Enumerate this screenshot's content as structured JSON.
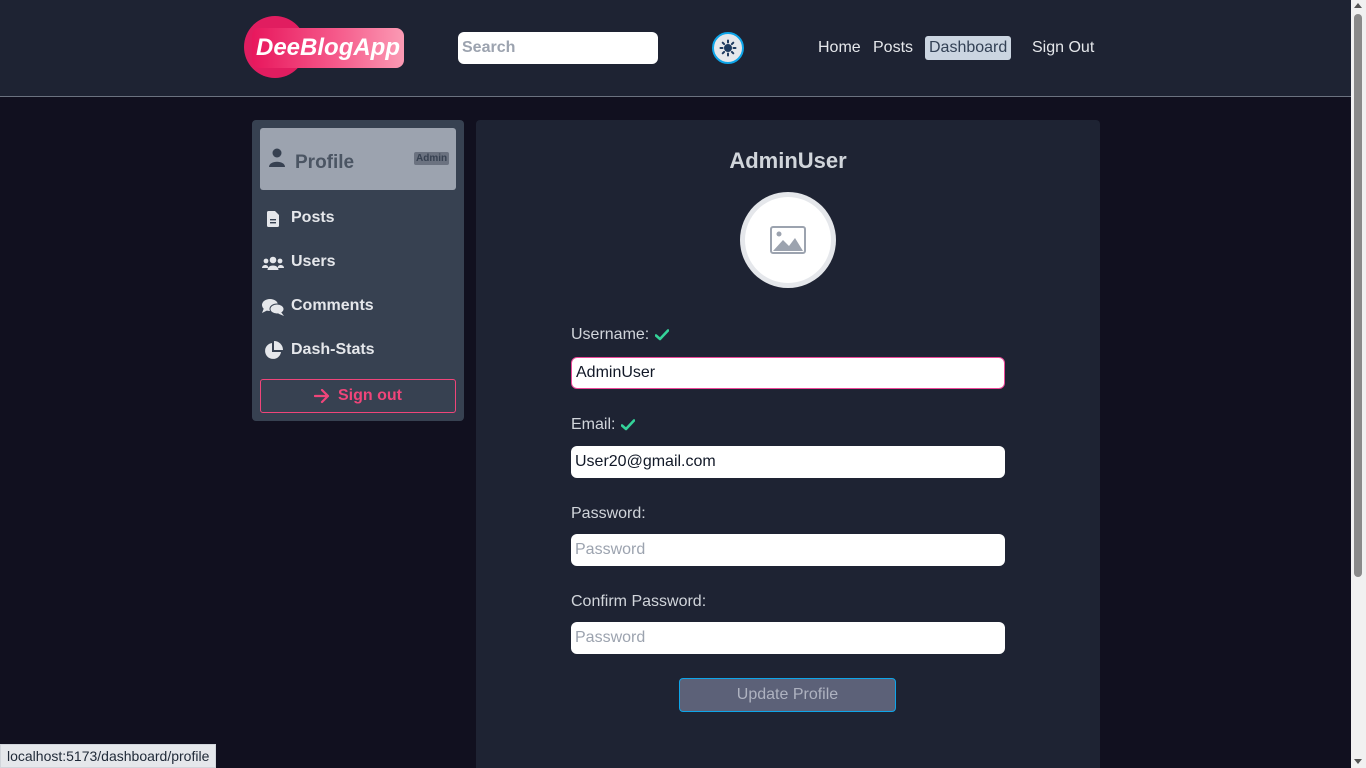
{
  "header": {
    "logo_text": "DeeBlogApp",
    "search_placeholder": "Search",
    "nav": {
      "home": "Home",
      "posts": "Posts",
      "dashboard": "Dashboard",
      "sign_out": "Sign Out"
    }
  },
  "sidebar": {
    "profile_label": "Profile",
    "profile_badge": "Admin",
    "items": [
      {
        "label": "Posts",
        "icon": "document-icon"
      },
      {
        "label": "Users",
        "icon": "users-icon"
      },
      {
        "label": "Comments",
        "icon": "comments-icon"
      },
      {
        "label": "Dash-Stats",
        "icon": "pie-chart-icon"
      }
    ],
    "sign_out_label": "Sign out"
  },
  "profile": {
    "username_display": "AdminUser",
    "username_label": "Username:",
    "username_value": "AdminUser",
    "email_label": "Email:",
    "email_value": "User20@gmail.com",
    "password_label": "Password:",
    "password_placeholder": "Password",
    "confirm_label": "Confirm Password:",
    "confirm_placeholder": "Password",
    "update_button": "Update Profile"
  },
  "status_bar": {
    "url": "localhost:5173/dashboard/profile"
  },
  "colors": {
    "accent_pink": "#f0457a",
    "valid_check": "#34d399",
    "page_bg": "#11101f",
    "panel_bg": "#1e2333"
  }
}
